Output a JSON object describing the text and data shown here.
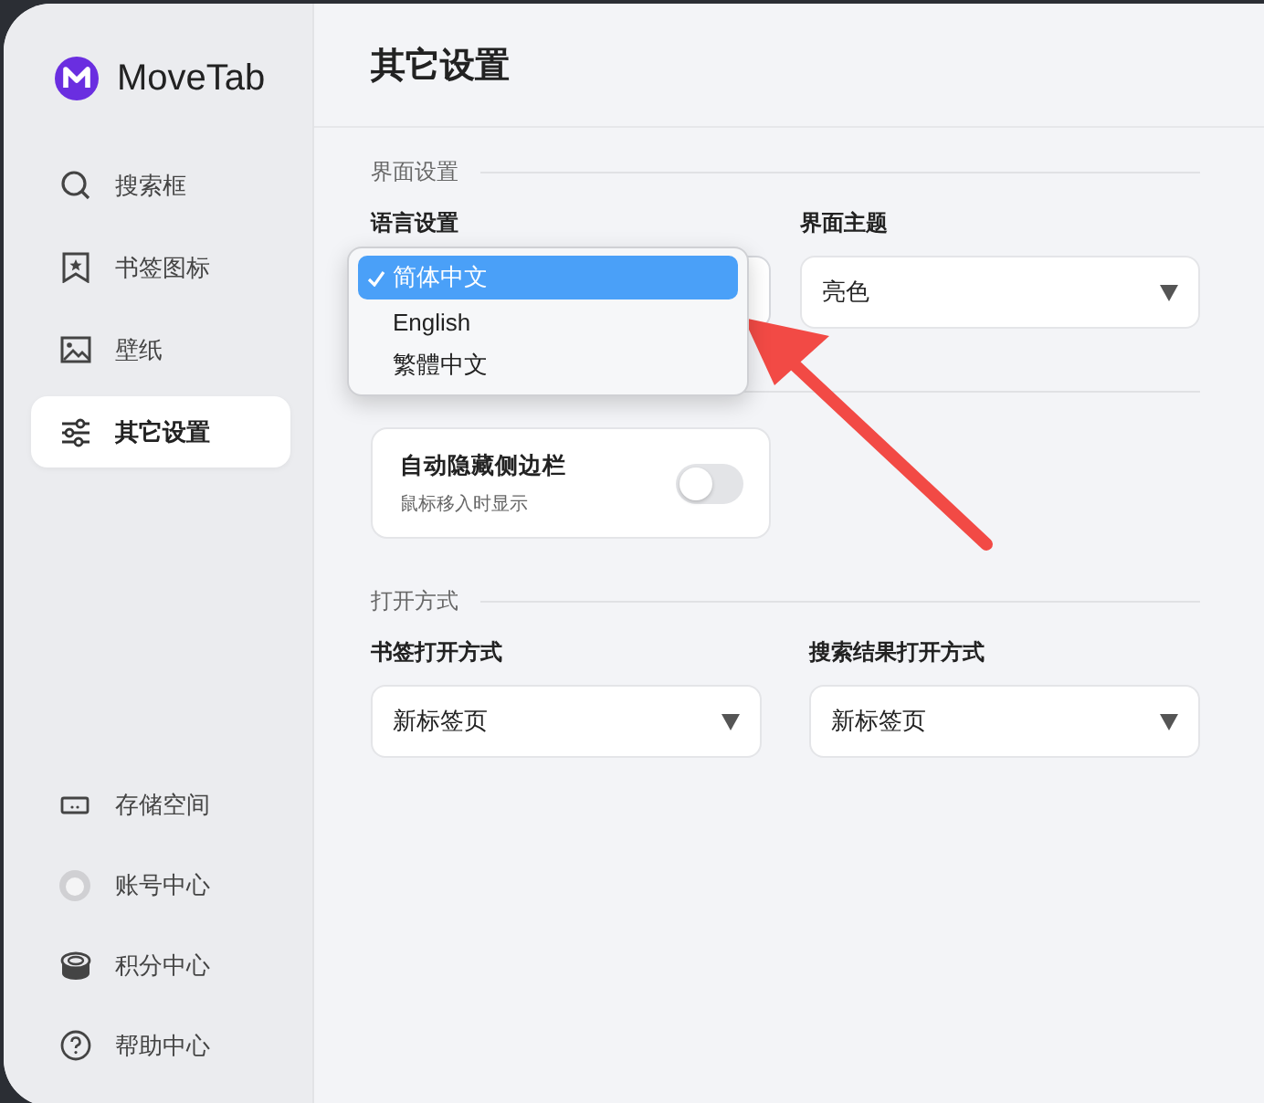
{
  "app": {
    "name": "MoveTab"
  },
  "sidebar": {
    "items": [
      {
        "label": "搜索框",
        "kind": "search",
        "selected": false
      },
      {
        "label": "书签图标",
        "kind": "bookmark",
        "selected": false
      },
      {
        "label": "壁纸",
        "kind": "image",
        "selected": false
      },
      {
        "label": "其它设置",
        "kind": "sliders",
        "selected": true
      }
    ],
    "bottom_items": [
      {
        "label": "存储空间",
        "kind": "storage"
      },
      {
        "label": "账号中心",
        "kind": "avatar"
      },
      {
        "label": "积分中心",
        "kind": "coins"
      },
      {
        "label": "帮助中心",
        "kind": "help"
      }
    ]
  },
  "page": {
    "title": "其它设置"
  },
  "sections": [
    {
      "title": "界面设置",
      "fields": [
        {
          "kind": "select",
          "label": "语言设置",
          "open": true,
          "options": [
            {
              "label": "简体中文",
              "selected": true
            },
            {
              "label": "English",
              "selected": false
            },
            {
              "label": "繁體中文",
              "selected": false
            }
          ]
        },
        {
          "kind": "select",
          "label": "界面主题",
          "value": "亮色",
          "open": false
        }
      ]
    },
    {
      "fields": [
        {
          "kind": "toggle",
          "label": "自动隐藏侧边栏",
          "description": "鼠标移入时显示",
          "on": false
        }
      ]
    },
    {
      "title": "打开方式",
      "fields": [
        {
          "kind": "select",
          "label": "书签打开方式",
          "value": "新标签页",
          "open": false
        },
        {
          "kind": "select",
          "label": "搜索结果打开方式",
          "value": "新标签页",
          "open": false
        }
      ]
    }
  ]
}
